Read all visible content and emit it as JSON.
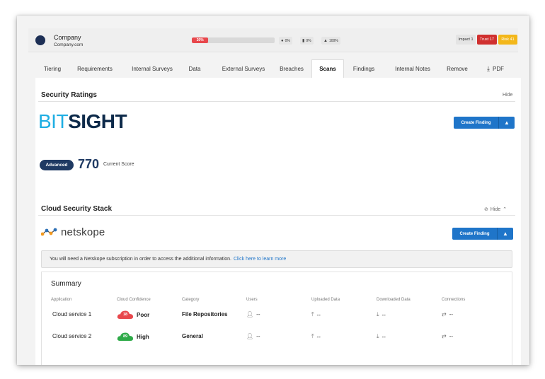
{
  "company": {
    "name": "Company",
    "domain": "Company.com"
  },
  "progress": {
    "label": "20%",
    "value": 20
  },
  "stats": [
    {
      "icon": "dot-icon",
      "text": "0%"
    },
    {
      "icon": "file-icon",
      "text": "0%"
    },
    {
      "icon": "warning-icon",
      "text": "100%"
    }
  ],
  "badges": {
    "impact": "Impact 1",
    "trust": "Trust 17",
    "risk": "Risk 41"
  },
  "tabs": [
    "Tiering",
    "Requirements",
    "Internal Surveys",
    "Data",
    "External Surveys",
    "Breaches",
    "Scans",
    "Findings",
    "Internal Notes",
    "Remove",
    "PDF"
  ],
  "active_tab": "Scans",
  "security_ratings": {
    "title": "Security Ratings",
    "hide": "Hide",
    "logo_bit": "BIT",
    "logo_sight": "SIGHT",
    "create_finding": "Create Finding",
    "rating_level": "Advanced",
    "score": "770",
    "score_label": "Current Score"
  },
  "cloud_stack": {
    "title": "Cloud Security Stack",
    "hide": "Hide",
    "logo": "netskope",
    "create_finding": "Create Finding",
    "notice": "You will need a Netskope subscription in order to access the additional information.",
    "notice_link": "Click here to learn more"
  },
  "summary": {
    "title": "Summary",
    "columns": [
      "Application",
      "Cloud Confidence",
      "Category",
      "Users",
      "Uploaded Data",
      "Downloaded Data",
      "Connections"
    ],
    "rows": [
      {
        "application": "Cloud service 1",
        "confidence_score": "18",
        "confidence": "Poor",
        "category": "File Repositories",
        "users": "--",
        "uploaded": "--",
        "downloaded": "--",
        "connections": "--"
      },
      {
        "application": "Cloud service 2",
        "confidence_score": "89",
        "confidence": "High",
        "category": "General",
        "users": "--",
        "uploaded": "--",
        "downloaded": "--",
        "connections": "--"
      }
    ]
  },
  "colors": {
    "accent": "#1f75c9",
    "navy": "#1f3a63",
    "poor": "#e8474c",
    "high": "#2eaa48",
    "trust": "#d0302f",
    "risk": "#f3b71a"
  }
}
